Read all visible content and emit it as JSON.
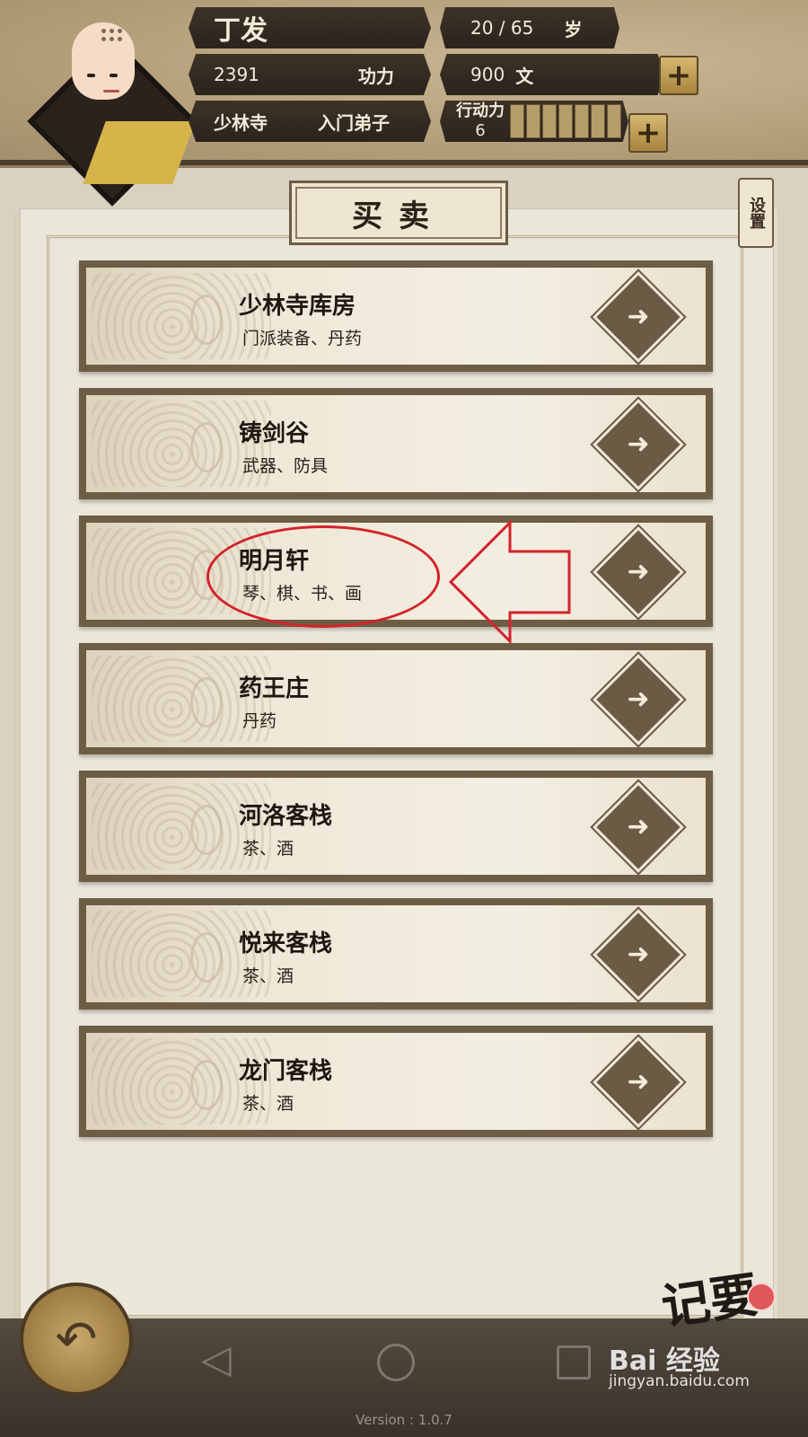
{
  "header": {
    "name": "丁发",
    "age": "20 / 65",
    "age_unit": "岁",
    "power_value": "2391",
    "power_label": "功力",
    "money_value": "900",
    "money_unit": "文",
    "sect": "少林寺",
    "rank": "入门弟子",
    "action_label": "行动力",
    "action_value": "6",
    "plus": "+"
  },
  "page": {
    "title": "买卖",
    "settings": "设置"
  },
  "shops": [
    {
      "name": "少林寺库房",
      "desc": "门派装备、丹药"
    },
    {
      "name": "铸剑谷",
      "desc": "武器、防具"
    },
    {
      "name": "明月轩",
      "desc": "琴、棋、书、画"
    },
    {
      "name": "药王庄",
      "desc": "丹药"
    },
    {
      "name": "河洛客栈",
      "desc": "茶、酒"
    },
    {
      "name": "悦来客栈",
      "desc": "茶、酒"
    },
    {
      "name": "龙门客栈",
      "desc": "茶、酒"
    }
  ],
  "icons": {
    "back": "back-arrow-icon",
    "go": "hand-arrow-icon"
  },
  "footer": {
    "version": "Version : 1.0.7",
    "notebook": "记要",
    "watermark": "Bai 经验",
    "watermark_url": "jingyan.baidu.com"
  },
  "colors": {
    "frame": "#6e5d45",
    "annotation": "#d3232a",
    "gold": "#d6b870"
  }
}
